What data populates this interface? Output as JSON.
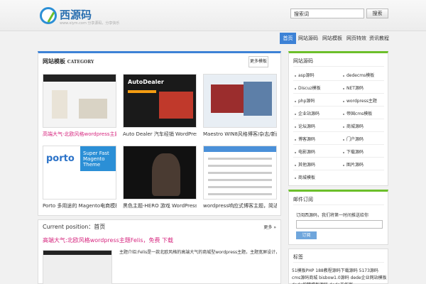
{
  "site": {
    "name": "西源码",
    "url_line": "www.xiym.com  分享源码，分享快乐"
  },
  "search": {
    "value": "搜索词",
    "button": "搜索"
  },
  "nav": [
    "首页",
    "网站源码",
    "网站模板",
    "网页特效",
    "资讯教程"
  ],
  "main": {
    "title": "网站模板",
    "title_en": "CATEGORY",
    "more": "更多模板",
    "cards": [
      {
        "title": "高端大气-北欧风格wordpress主题Felis",
        "thumb_brand": "FELIS"
      },
      {
        "title": "Auto Dealer 汽车经销 WordPress主题",
        "thumb_brand": "AutoDealer"
      },
      {
        "title": "Maestro WIN8风格博客/杂志/新闻主题 W",
        "thumb_brand": "MAESTRO"
      },
      {
        "title": "Porto 多用途的 Magento电商模板",
        "thumb_brand": "porto",
        "thumb_sub": "Super Fast Magento Theme"
      },
      {
        "title": "黑色主题-HERO 游戏 WordPress主题",
        "thumb_brand": "HERO"
      },
      {
        "title": "wordpress响应式博客主题，简洁YPMo",
        "thumb_brand": ""
      }
    ]
  },
  "position": {
    "label": "Current position：首页",
    "more": "更多 »",
    "post_title": "高端大气:北欧风格wordpress主题Felis，免费 下载",
    "excerpt": "主题介绍:Felis是一款北欧风格的高端大气的商城型wordpress主题，主题宽屏设计，适合做SEO[...]"
  },
  "sidebar": {
    "cat_title": "网站源码",
    "links": [
      [
        "asp源码",
        "dedecms模板"
      ],
      [
        "Discuz模板",
        "NET源码"
      ],
      [
        "php源码",
        "wordpress主题"
      ],
      [
        "企业站源码",
        "帝国cms模板"
      ],
      [
        "论坛源码",
        "商城源码"
      ],
      [
        "博客源码",
        "门户源码"
      ],
      [
        "电影源码",
        "下载源码"
      ],
      [
        "其他源码",
        "图片源码"
      ],
      [
        "商城模板",
        ""
      ]
    ],
    "sub_title": "邮件订阅",
    "sub_text": "订阅西源码，我们将第一时间推送给你",
    "sub_button": "订阅",
    "tags_title": "标签",
    "tags_text": "51模板PHP  188教程源码下载源码  5173源码  cms源码商城 bisbow1.0源码  dede企业网站模板  dede织梦模板源码  dede工作室"
  }
}
